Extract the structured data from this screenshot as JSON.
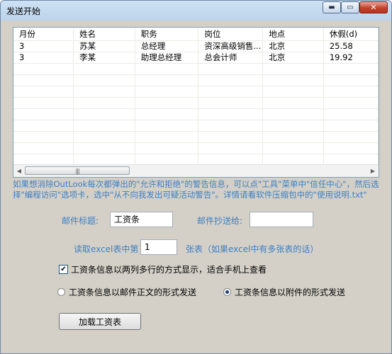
{
  "window": {
    "title": "发送开始",
    "minimize": "▬",
    "maximize": "▭",
    "close": "✕"
  },
  "grid": {
    "columns": [
      "月份",
      "姓名",
      "职务",
      "岗位",
      "地点",
      "休假(d)"
    ],
    "rows": [
      [
        "3",
        "苏某",
        "总经理",
        "资深高级销售...",
        "北京",
        "25.58"
      ],
      [
        "3",
        "李某",
        "助理总经理",
        "总会计师",
        "北京",
        "19.92"
      ]
    ],
    "scroll_left": "◀",
    "scroll_right": "▶",
    "scroll_grip": "|||"
  },
  "notice": "如果想消除OutLook每次都弹出的\"允许和拒绝\"的警告信息，可以点\"工具\"菜单中\"信任中心\"，然后选择\"编程访问\"选项卡，选中\"从不向我发出可疑活动警告\"。详情请看软件压缩包中的\"使用说明.txt\"",
  "form": {
    "subject_label": "邮件标题:",
    "subject_value": "工资条",
    "cc_label": "邮件抄送给:",
    "cc_value": "",
    "sheet_label": "读取excel表中第",
    "sheet_value": "1",
    "sheet_suffix": "张表（如果excel中有多张表的话）",
    "multirow_checked": true,
    "multirow_label": "工资条信息以两列多行的方式显示，适合手机上查看",
    "radio_body_label": "工资条信息以邮件正文的形式发送",
    "radio_attach_label": "工资条信息以附件的形式发送",
    "selected_mode": "attachment",
    "load_button": "加载工资表"
  },
  "colors": {
    "accent_text": "#3c7fc3",
    "close_button": "#c5402c"
  }
}
